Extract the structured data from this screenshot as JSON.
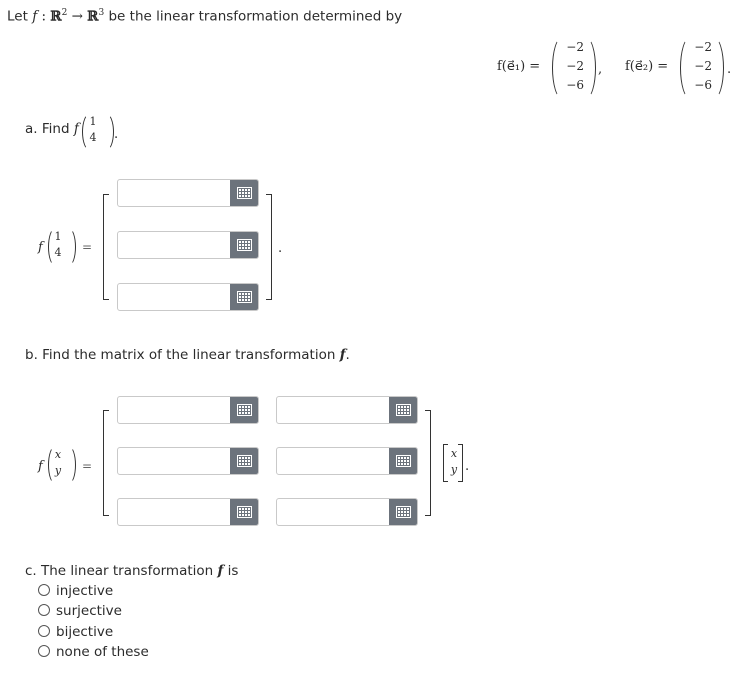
{
  "intro": {
    "prefix": "Let",
    "f": "f",
    "colon": ":",
    "domain": "ℝ",
    "domain_exp": "2",
    "arrow": "→",
    "codomain": "ℝ",
    "codomain_exp": "3",
    "suffix": "be the linear transformation determined by"
  },
  "given": {
    "e1_label": "f(e⃗₁) =",
    "e1_vector": [
      "−2",
      "−2",
      "−6"
    ],
    "comma": ",",
    "e2_label": "f(e⃗₂) =",
    "e2_vector": [
      "−2",
      "−2",
      "−6"
    ],
    "period": "."
  },
  "part_a": {
    "prompt": "a. Find",
    "f": "f",
    "vector": [
      "1",
      "4"
    ],
    "period": ".",
    "lhs_f": "f",
    "lhs_vector": [
      "1",
      "4"
    ],
    "equals": "=",
    "inputs": [
      {
        "value": "",
        "placeholder": ""
      },
      {
        "value": "",
        "placeholder": ""
      },
      {
        "value": "",
        "placeholder": ""
      }
    ],
    "trail": "."
  },
  "part_b": {
    "prompt": "b. Find the matrix of the linear transformation",
    "f": "f",
    "period": ".",
    "lhs_f": "f",
    "lhs_vector": [
      "x",
      "y"
    ],
    "equals": "=",
    "matrix_inputs": [
      [
        {
          "value": ""
        },
        {
          "value": ""
        }
      ],
      [
        {
          "value": ""
        },
        {
          "value": ""
        }
      ],
      [
        {
          "value": ""
        },
        {
          "value": ""
        }
      ]
    ],
    "rhs_vector": [
      "x",
      "y"
    ],
    "trail": "."
  },
  "part_c": {
    "prompt": "c. The linear transformation",
    "f": "f",
    "is": "is",
    "options": [
      {
        "label": "injective",
        "selected": false
      },
      {
        "label": "surjective",
        "selected": false
      },
      {
        "label": "bijective",
        "selected": false
      },
      {
        "label": "none of these",
        "selected": false
      }
    ]
  },
  "icons": {
    "keypad": "math-keypad-icon"
  },
  "colors": {
    "keypad_bg": "#6c737c",
    "input_border": "#c9c9c9",
    "text": "#2b2b2b"
  }
}
